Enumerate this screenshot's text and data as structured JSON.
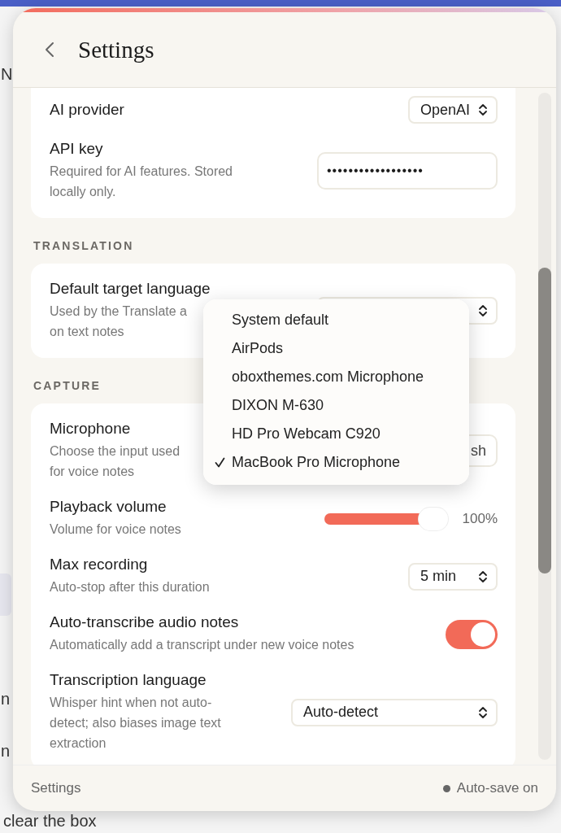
{
  "background": {
    "texts": [
      "N",
      "n",
      "n",
      "clear the box"
    ]
  },
  "window": {
    "title": "Settings"
  },
  "sections": [
    {
      "rows": [
        {
          "kind": "select",
          "label": "AI provider",
          "value": "OpenAI"
        },
        {
          "kind": "password",
          "label": "API key",
          "description": [
            "Required for AI features. Stored",
            "locally only."
          ],
          "value": "••••••••••••••••••"
        }
      ]
    },
    {
      "heading": "TRANSLATION",
      "rows": [
        {
          "kind": "select",
          "label": "Default target language",
          "description": [
            "Used by the Translate a",
            "on text notes"
          ]
        }
      ]
    },
    {
      "heading": "CAPTURE",
      "rows": [
        {
          "kind": "button",
          "label": "Microphone",
          "description": [
            "Choose the input used",
            "for voice notes"
          ],
          "value": "sh"
        },
        {
          "kind": "slider",
          "label": "Playback volume",
          "description": [
            "Volume for voice notes"
          ],
          "level": 1,
          "reading": "100%"
        },
        {
          "kind": "select",
          "label": "Max recording",
          "description": [
            "Auto-stop after this duration"
          ],
          "value": "5 min"
        },
        {
          "kind": "toggle",
          "label": "Auto-transcribe audio notes",
          "description": [
            "Automatically add a transcript under new voice notes"
          ],
          "on": true
        },
        {
          "kind": "select",
          "label": "Transcription language",
          "description": [
            "Whisper hint when not auto-",
            "detect; also biases image text",
            "extraction"
          ],
          "value": "Auto-detect",
          "wide": true
        }
      ]
    }
  ],
  "menu": {
    "items": [
      {
        "label": "System default",
        "selected": false
      },
      {
        "label": "AirPods",
        "selected": false
      },
      {
        "label": "oboxthemes.com Microphone",
        "selected": false
      },
      {
        "label": "DIXON M-630",
        "selected": false
      },
      {
        "label": "HD Pro Webcam C920",
        "selected": false
      },
      {
        "label": "MacBook Pro Microphone",
        "selected": true
      }
    ]
  },
  "footer": {
    "left": "Settings",
    "status": "Auto-save on"
  }
}
